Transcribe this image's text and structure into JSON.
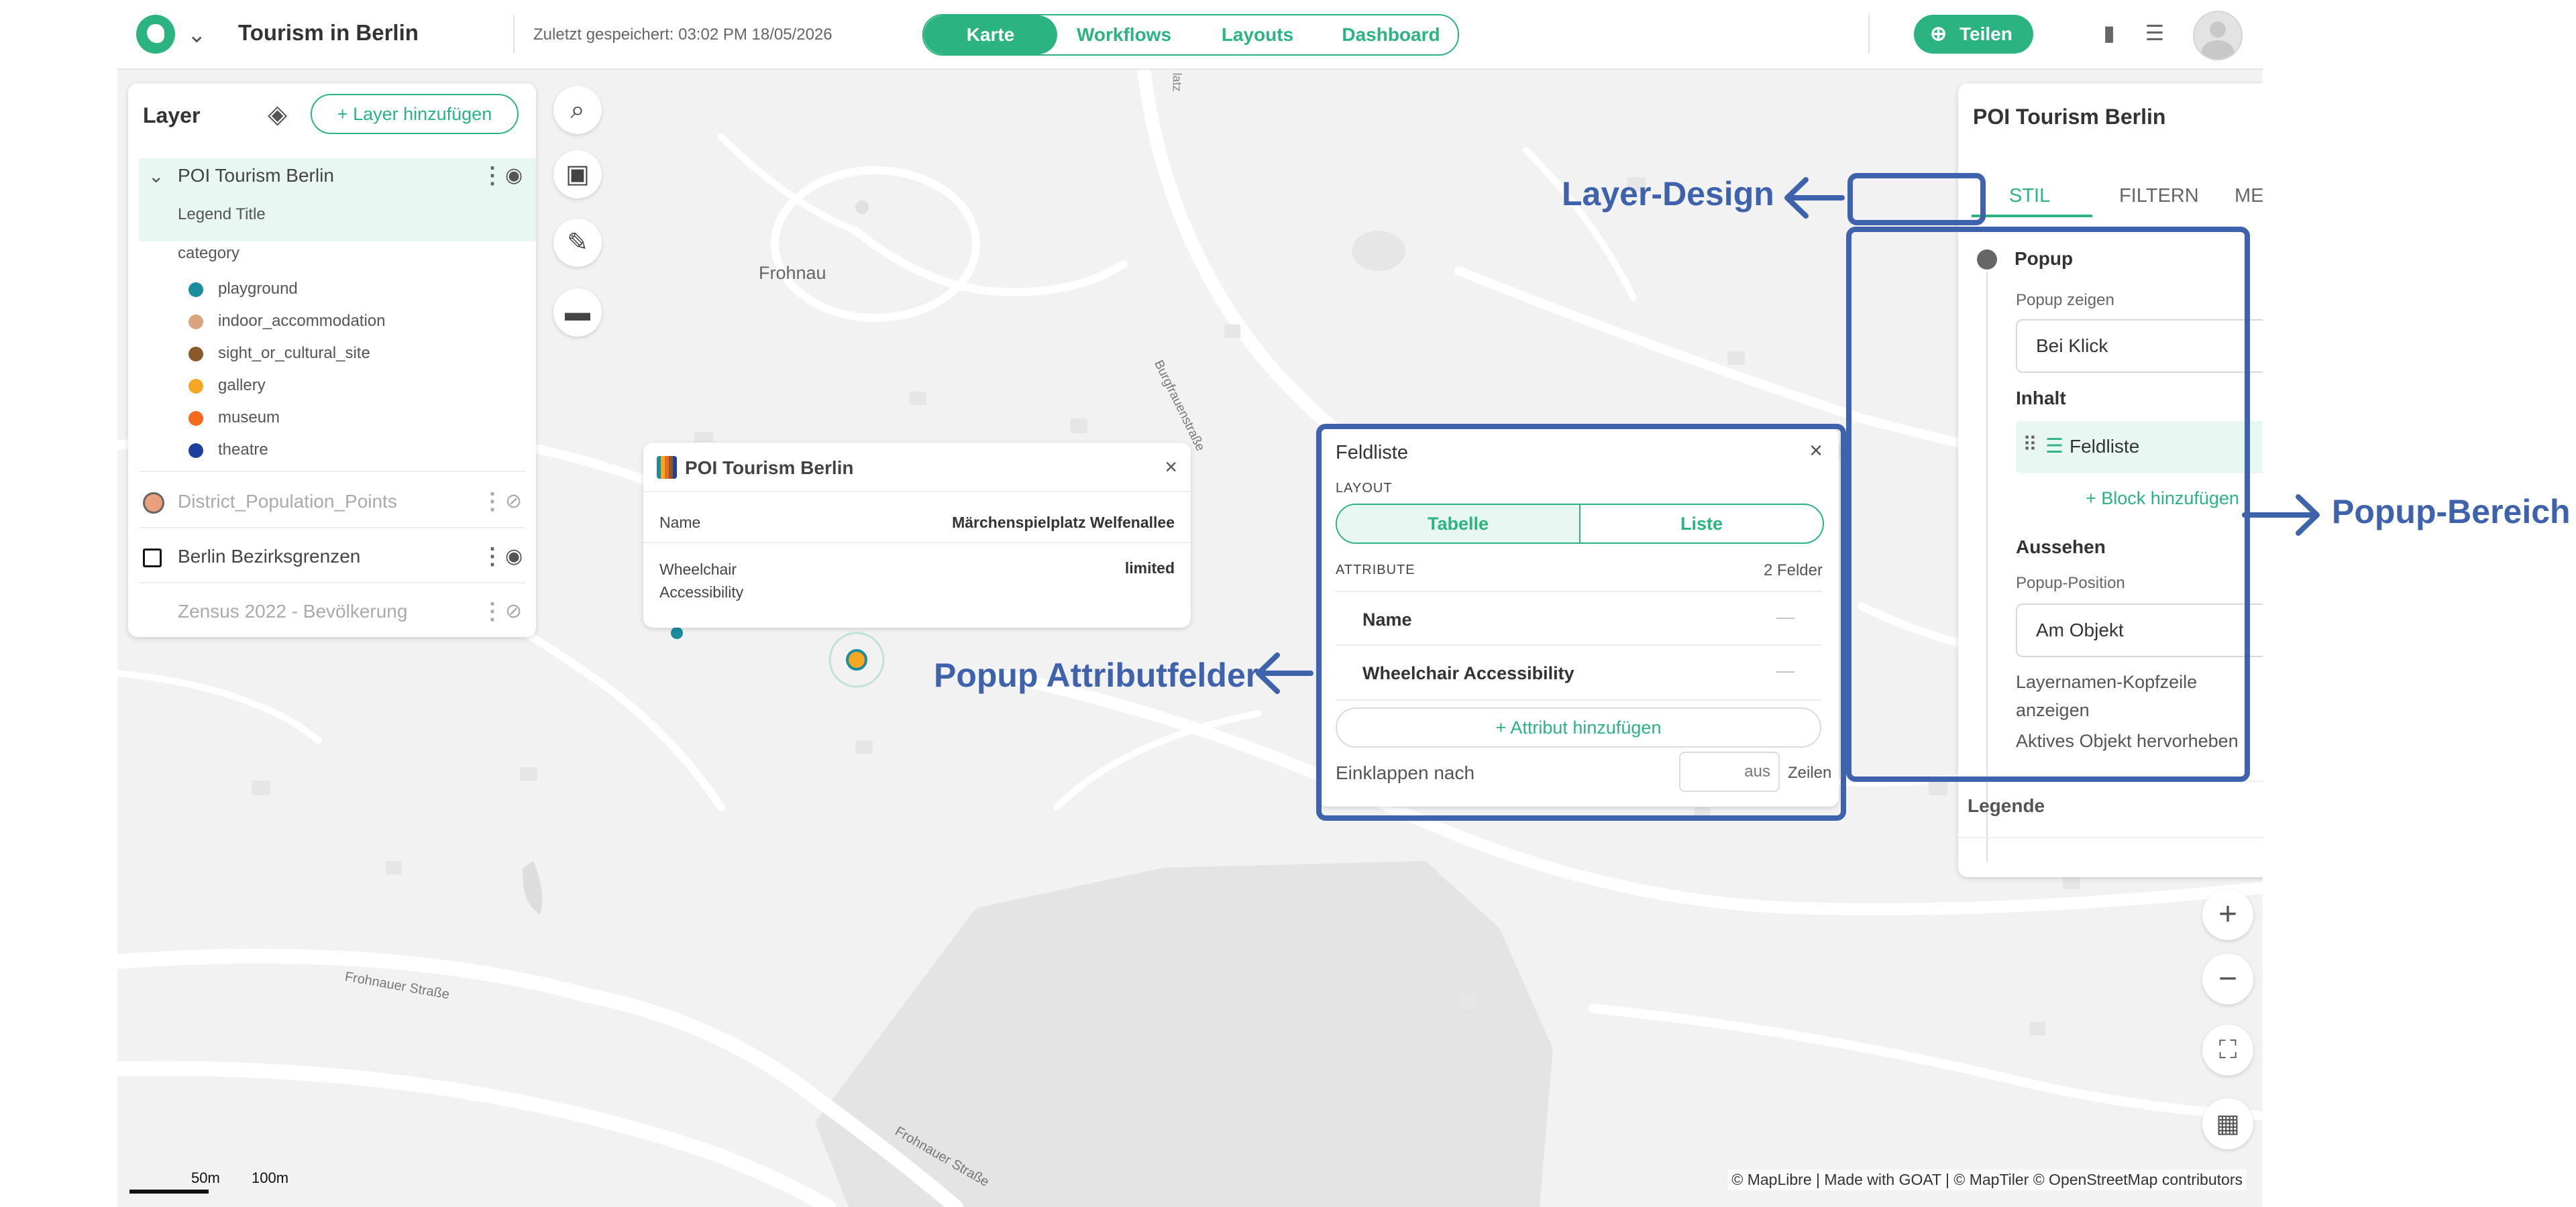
{
  "header": {
    "title": "Tourism in Berlin",
    "saved": "Zuletzt gespeichert: 03:02 PM 18/05/2026",
    "nav": [
      "Karte",
      "Workflows",
      "Layouts",
      "Dashboard"
    ],
    "share": "Teilen"
  },
  "layers": {
    "title": "Layer",
    "add": "Layer hinzufügen",
    "poi": {
      "name": "POI Tourism Berlin",
      "legend_title": "Legend Title",
      "field": "category",
      "items": [
        {
          "label": "playground",
          "color": "#1a8c9c"
        },
        {
          "label": "indoor_accommodation",
          "color": "#d9a57c"
        },
        {
          "label": "sight_or_cultural_site",
          "color": "#8a5a2c"
        },
        {
          "label": "gallery",
          "color": "#f5a623"
        },
        {
          "label": "museum",
          "color": "#f26b1d"
        },
        {
          "label": "theatre",
          "color": "#1f3f9e"
        }
      ]
    },
    "district": "District_Population_Points",
    "bezirk": "Berlin Bezirksgrenzen",
    "zensus": "Zensus 2022 - Bevölkerung"
  },
  "map": {
    "labels": {
      "frohnau": "Frohnau",
      "burg": "Burgfrauenstraße",
      "frohnauer1": "Frohnauer Straße",
      "frohnauer2": "Frohnauer Straße",
      "latz": "latz"
    },
    "scale": {
      "a": "50m",
      "b": "100m"
    },
    "attribution": "© MapLibre | Made with GOAT | © MapTiler © OpenStreetMap contributors"
  },
  "mappopup": {
    "title": "POI Tourism Berlin",
    "rows": [
      {
        "label": "Name",
        "value": "Märchenspielplatz Welfenallee"
      },
      {
        "label": "Wheelchair Accessibility",
        "value": "limited"
      }
    ]
  },
  "feldliste": {
    "title": "Feldliste",
    "layout_label": "LAYOUT",
    "layout_options": [
      "Tabelle",
      "Liste"
    ],
    "attribute_label": "ATTRIBUTE",
    "attribute_count": "2 Felder",
    "attributes": [
      "Name",
      "Wheelchair Accessibility"
    ],
    "dash": "—",
    "add_attribute": "Attribut hinzufügen",
    "collapse_label": "Einklappen nach",
    "collapse_placeholder": "aus",
    "collapse_unit": "Zeilen"
  },
  "props": {
    "title": "POI Tourism Berlin",
    "tabs": [
      "STIL",
      "FILTERN",
      "METADATEN"
    ],
    "popup": "Popup",
    "popup_show_label": "Popup zeigen",
    "popup_show_value": "Bei Klick",
    "content_label": "Inhalt",
    "block_name": "Feldliste",
    "add_block": "Block hinzufügen",
    "appearance_label": "Aussehen",
    "position_label": "Popup-Position",
    "position_value": "Am Objekt",
    "layername_header": "Layernamen-Kopfzeile anzeigen",
    "highlight": "Aktives Objekt hervorheben",
    "legend": "Legende"
  },
  "annotations": {
    "layer_design": "Layer-Design",
    "popup_bereich": "Popup-Bereich",
    "popup_attr": "Popup Attributfelder"
  },
  "colors": {
    "accent": "#2bb381",
    "annotation": "#3f62ad"
  }
}
